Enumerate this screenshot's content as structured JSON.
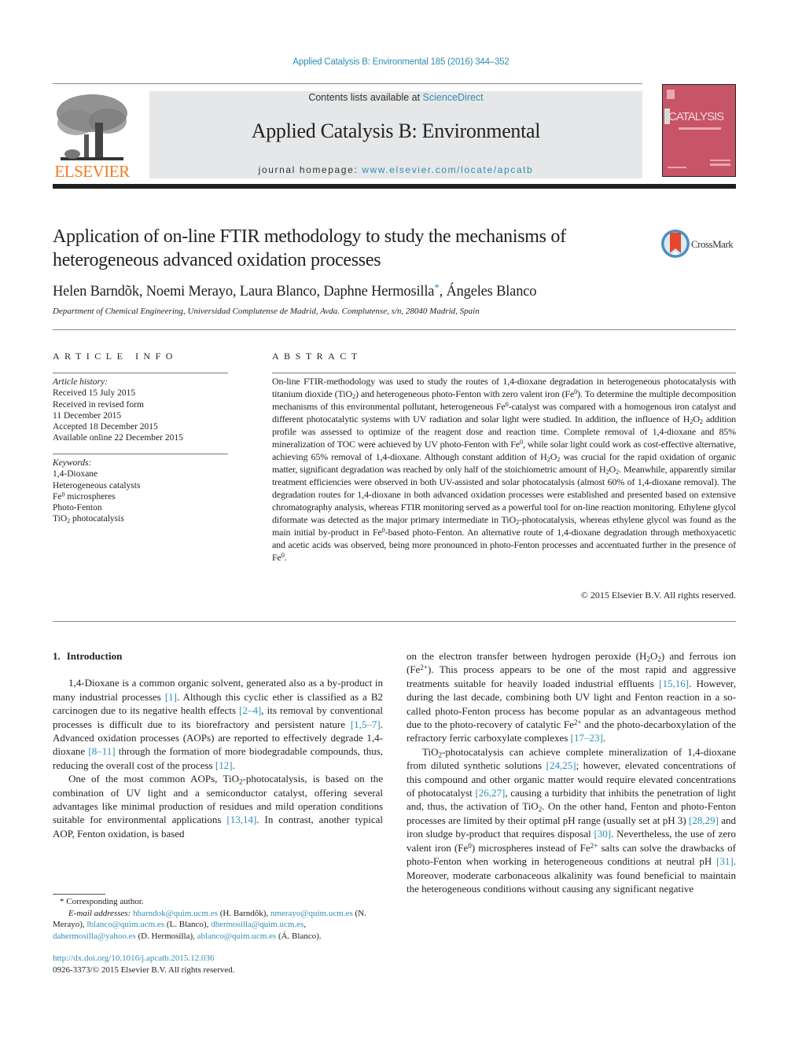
{
  "header": {
    "citation": "Applied Catalysis B: Environmental 185 (2016) 344–352",
    "contents_prefix": "Contents lists available at ",
    "contents_link": "ScienceDirect",
    "journal_title": "Applied Catalysis B: Environmental",
    "homepage_prefix": "journal homepage: ",
    "homepage_link": "www.elsevier.com/locate/apcatb",
    "publisher_logo_text": "ELSEVIER",
    "cover_word": "CATALYSIS",
    "brand_color": "#f47a20",
    "link_color": "#2f8fb5",
    "cover_color": "#c85468"
  },
  "article": {
    "title": "Application of on-line FTIR methodology to study the mechanisms of heterogeneous advanced oxidation processes",
    "crossmark_label": "CrossMark",
    "authors_before_star": "Helen Barndõk, Noemi Merayo, Laura Blanco, Daphne Hermosilla",
    "author_star": "*",
    "authors_after_star": ", Ángeles Blanco",
    "affiliation": "Department of Chemical Engineering, Universidad Complutense de Madrid, Avda. Complutense, s/n, 28040 Madrid, Spain"
  },
  "article_info": {
    "heading": "ARTICLE INFO",
    "history_label": "Article history:",
    "history": [
      "Received 15 July 2015",
      "Received in revised form",
      "11 December 2015",
      "Accepted 18 December 2015",
      "Available online 22 December 2015"
    ],
    "keywords_label": "Keywords:",
    "keywords": [
      {
        "text": "1,4-Dioxane"
      },
      {
        "text": "Heterogeneous catalysts"
      },
      {
        "pre": "Fe",
        "sup": "0",
        "post": " microspheres"
      },
      {
        "text": "Photo-Fenton"
      },
      {
        "pre": "TiO",
        "sub": "2",
        "post": " photocatalysis"
      }
    ]
  },
  "abstract": {
    "heading": "ABSTRACT",
    "segments": [
      "On-line FTIR-methodology was used to study the routes of 1,4-dioxane degradation in heterogeneous photocatalysis with titanium dioxide (TiO",
      "2",
      ") and heterogeneous photo-Fenton with zero valent iron (Fe",
      "0",
      "). To determine the multiple decomposition mechanisms of this environmental pollutant, heterogeneous Fe",
      "0",
      "-catalyst was compared with a homogenous iron catalyst and different photocatalytic systems with UV radiation and solar light were studied. In addition, the influence of H",
      "2",
      "O",
      "2",
      " addition profile was assessed to optimize of the reagent dose and reaction time. Complete removal of 1,4-dioxane and 85% mineralization of TOC were achieved by UV photo-Fenton with Fe",
      "0",
      ", while solar light could work as cost-effective alternative, achieving 65% removal of 1,4-dioxane. Although constant addition of H",
      "2",
      "O",
      "2",
      " was crucial for the rapid oxidation of organic matter, significant degradation was reached by only half of the stoichiometric amount of H",
      "2",
      "O",
      "2",
      ". Meanwhile, apparently similar treatment efficiencies were observed in both UV-assisted and solar photocatalysis (almost 60% of 1,4-dioxane removal). The degradation routes for 1,4-dioxane in both advanced oxidation processes were established and presented based on extensive chromatography analysis, whereas FTIR monitoring served as a powerful tool for on-line reaction monitoring. Ethylene glycol diformate was detected as the major primary intermediate in TiO",
      "2",
      "-photocatalysis, whereas ethylene glycol was found as the main initial by-product in Fe",
      "0",
      "-based photo-Fenton. An alternative route of 1,4-dioxane degradation through methoxyacetic and acetic acids was observed, being more pronounced in photo-Fenton processes and accentuated further in the presence of Fe",
      "0",
      "."
    ],
    "copyright": "© 2015 Elsevier B.V. All rights reserved."
  },
  "body": {
    "section_number": "1.",
    "section_title": "Introduction",
    "p1": {
      "t1": "1,4-Dioxane is a common organic solvent, generated also as a by-product in many industrial processes ",
      "r1": "[1]",
      "t2": ". Although this cyclic ether is classified as a B2 carcinogen due to its negative health effects ",
      "r2": "[2–4]",
      "t3": ", its removal by conventional processes is difficult due to its biorefractory and persistent nature ",
      "r3": "[1,5–7]",
      "t4": ". Advanced oxidation processes (AOPs) are reported to effectively degrade 1,4-dioxane ",
      "r4": "[8–11]",
      "t5": " through the formation of more biodegradable compounds, thus, reducing the overall cost of the process ",
      "r5": "[12]",
      "t6": "."
    },
    "p2": {
      "t1": "One of the most common AOPs, TiO",
      "s1": "2",
      "t2": "-photocatalysis, is based on the combination of UV light and a semiconductor catalyst, offering several advantages like minimal production of residues and mild operation conditions suitable for environmental applications ",
      "r1": "[13,14]",
      "t3": ". In contrast, another typical AOP, Fenton oxidation, is based"
    },
    "p3": {
      "t1": "on the electron transfer between hydrogen peroxide (H",
      "s1": "2",
      "t2": "O",
      "s2": "2",
      "t3": ") and ferrous ion (Fe",
      "u1": "2+",
      "t4": "). This process appears to be one of the most rapid and aggressive treatments suitable for heavily loaded industrial effluents ",
      "r1": "[15,16]",
      "t5": ". However, during the last decade, combining both UV light and Fenton reaction in a so-called photo-Fenton process has become popular as an advantageous method due to the photo-recovery of catalytic Fe",
      "u2": "2+",
      "t6": " and the photo-decarboxylation of the refractory ferric carboxylate complexes ",
      "r2": "[17–23]",
      "t7": "."
    },
    "p4": {
      "t1": "TiO",
      "s1": "2",
      "t2": "-photocatalysis can achieve complete mineralization of 1,4-dioxane from diluted synthetic solutions ",
      "r1": "[24,25]",
      "t3": "; however, elevated concentrations of this compound and other organic matter would require elevated concentrations of photocatalyst ",
      "r2": "[26,27]",
      "t4": ", causing a turbidity that inhibits the penetration of light and, thus, the activation of TiO",
      "s2": "2",
      "t5": ". On the other hand, Fenton and photo-Fenton processes are limited by their optimal pH range (usually set at pH 3) ",
      "r3": "[28,29]",
      "t6": " and iron sludge by-product that requires disposal ",
      "r4": "[30]",
      "t7": ". Nevertheless, the use of zero valent iron (Fe",
      "u1": "0",
      "t8": ") microspheres instead of Fe",
      "u2": "2+",
      "t9": " salts can solve the drawbacks of photo-Fenton when working in heterogeneous conditions at neutral pH ",
      "r5": "[31]",
      "t10": ". Moreover, moderate carbonaceous alkalinity was found beneficial to maintain the heterogeneous conditions without causing any significant negative"
    }
  },
  "footnotes": {
    "star": "*",
    "corresponding": "Corresponding author.",
    "email_label": "E-mail addresses:",
    "emails": [
      {
        "address": "hbarndok@quim.ucm.es",
        "owner": " (H. Barndõk), "
      },
      {
        "address": "nmerayo@quim.ucm.es",
        "owner": " (N. Merayo), "
      },
      {
        "address": "lblanco@quim.ucm.es",
        "owner": " (L. Blanco), "
      },
      {
        "address": "dhermosilla@quim.ucm.es",
        "owner": ", "
      },
      {
        "address": "dahermosilla@yahoo.es",
        "owner": " (D. Hermosilla), "
      },
      {
        "address": "ablanco@quim.ucm.es",
        "owner": " (Á. Blanco)."
      }
    ],
    "doi": "http://dx.doi.org/10.1016/j.apcatb.2015.12.036",
    "issn_copyright": "0926-3373/© 2015 Elsevier B.V. All rights reserved."
  }
}
